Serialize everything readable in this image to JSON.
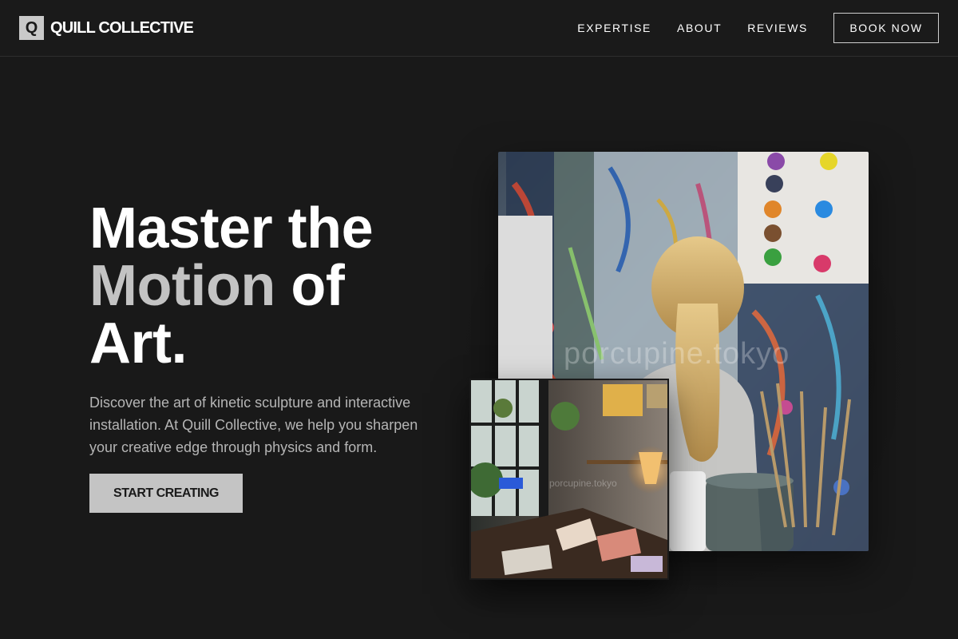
{
  "header": {
    "logo_letter": "Q",
    "brand": "QUILL COLLECTIVE",
    "nav": [
      {
        "label": "EXPERTISE"
      },
      {
        "label": "ABOUT"
      },
      {
        "label": "REVIEWS"
      }
    ],
    "cta_label": "BOOK NOW"
  },
  "hero": {
    "title_line1": "Master the",
    "title_muted": "Motion",
    "title_line2_rest": " of",
    "title_line3": "Art.",
    "description": "Discover the art of kinetic sculpture and interactive installation. At Quill Collective, we help you sharpen your creative edge through physics and form.",
    "button_label": "START CREATING"
  },
  "collage": {
    "main_photo": {
      "subject": "child painting on paint-splattered wall",
      "watermark": "porcupine.tokyo"
    },
    "small_photo": {
      "subject": "cozy art studio desk by window",
      "watermark": "porcupine.tokyo"
    }
  },
  "colors": {
    "background": "#191919",
    "accent_muted": "#c3c3c3",
    "button_bg": "#c4c4c4",
    "text_secondary": "#b5b5b5"
  }
}
